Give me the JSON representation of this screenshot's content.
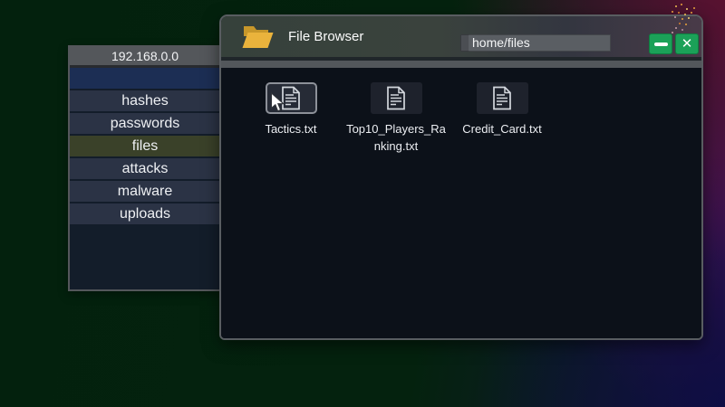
{
  "colors": {
    "accent_green": "#1ba158",
    "selected_blue_row": "#1c2e54",
    "active_row_olive": "#3a4129",
    "panel_row": "#2b3345",
    "panel_header_gray": "#54575b",
    "titlebar_green": "#3a423d",
    "window_bg": "#0c1119",
    "folder_yellow": "#eab33c",
    "spark_orange": "#e8a23c"
  },
  "target_panel": {
    "title": "192.168.0.0",
    "items": [
      "hashes",
      "passwords",
      "files",
      "attacks",
      "malware",
      "uploads"
    ],
    "active_item": "files"
  },
  "file_browser": {
    "title": "File Browser",
    "path_input": {
      "value": "home/files"
    },
    "window_controls": {
      "minimize": "minimize",
      "close": "✕"
    },
    "files": [
      {
        "name": "Tactics.txt",
        "hovered": true
      },
      {
        "name": "Top10_Players_Ranking.txt",
        "hovered": false
      },
      {
        "name": "Credit_Card.txt",
        "hovered": false
      }
    ]
  },
  "icons": {
    "folder": "open-folder",
    "file": "text-document",
    "minimize": "–",
    "close": "✕",
    "cursor": "arrow-pointer"
  }
}
